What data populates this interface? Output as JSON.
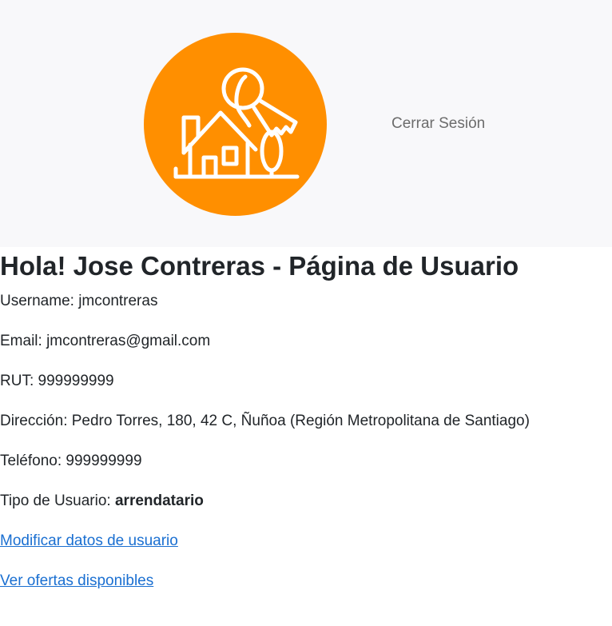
{
  "brand": {
    "logo_icon": "house-key-icon",
    "logo_color": "#ff8f00"
  },
  "nav": {
    "logout_label": "Cerrar Sesión"
  },
  "page": {
    "title": "Hola! Jose Contreras - Página de Usuario"
  },
  "user": {
    "username_label": "Username: ",
    "username": "jmcontreras",
    "email_label": "Email: ",
    "email": "jmcontreras@gmail.com",
    "rut_label": "RUT: ",
    "rut": "999999999",
    "address_label": "Dirección: ",
    "address": "Pedro Torres, 180, 42 C, Ñuñoa (Región Metropolitana de Santiago)",
    "phone_label": "Teléfono: ",
    "phone": "999999999",
    "type_label": "Tipo de Usuario: ",
    "type": "arrendatario"
  },
  "links": {
    "edit_user": "Modificar datos de usuario",
    "view_offers": "Ver ofertas disponibles"
  },
  "colors": {
    "navbar_bg": "#f8f8fa",
    "link": "#1a6fd1"
  }
}
